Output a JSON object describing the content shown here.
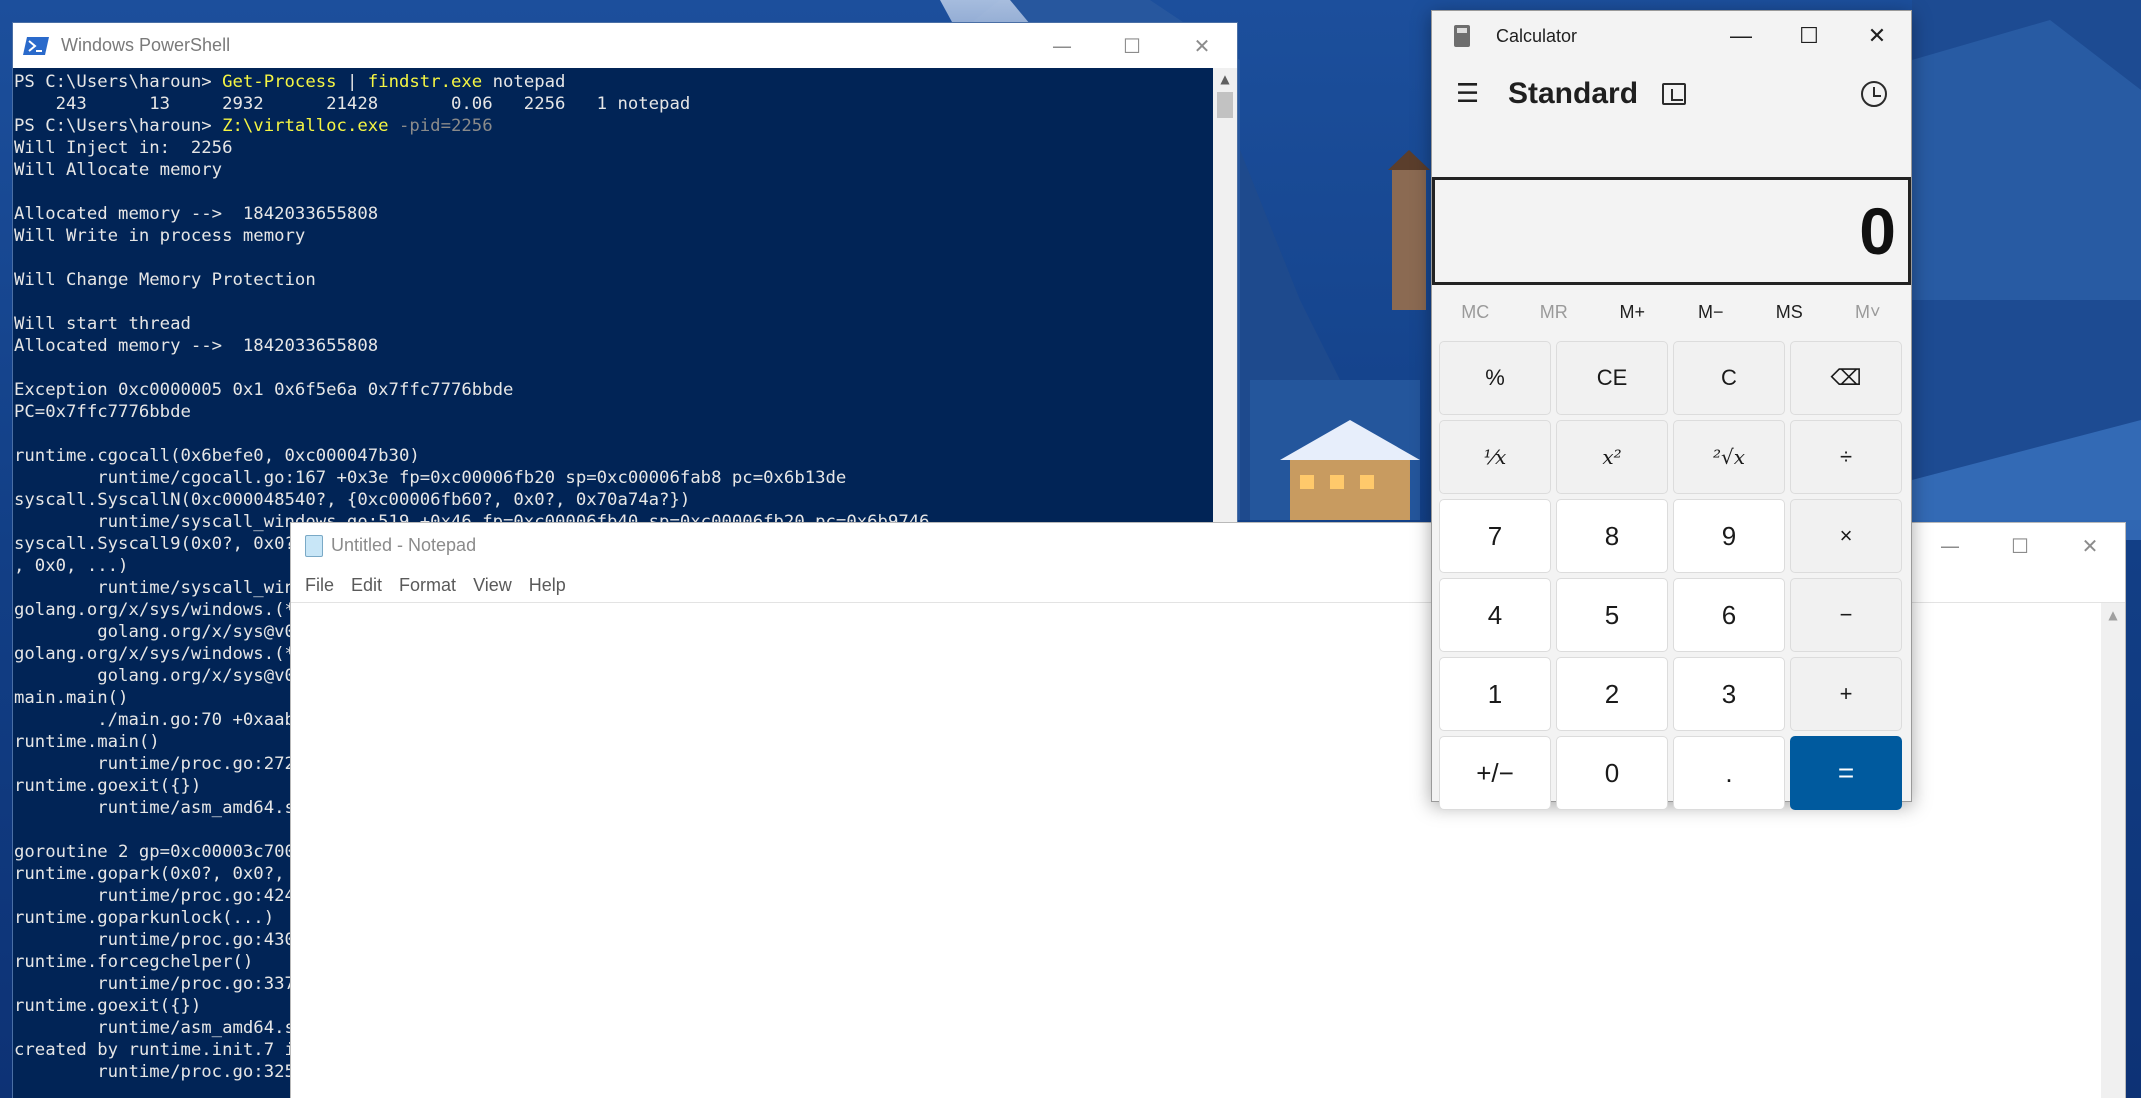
{
  "desktop": {
    "wallpaper": "mountain-village-night"
  },
  "powershell": {
    "title": "Windows PowerShell",
    "lines": [
      [
        {
          "t": "PS C:\\Users\\haroun> ",
          "c": "text"
        },
        {
          "t": "Get-Process",
          "c": "cmd"
        },
        {
          "t": " | ",
          "c": "text"
        },
        {
          "t": "findstr.exe",
          "c": "cmd"
        },
        {
          "t": " notepad",
          "c": "text"
        }
      ],
      [
        {
          "t": "    243      13     2932      21428       0.06   2256   1 notepad",
          "c": "text"
        }
      ],
      [
        {
          "t": "PS C:\\Users\\haroun> ",
          "c": "text"
        },
        {
          "t": "Z:\\virtalloc.exe",
          "c": "cmd"
        },
        {
          "t": " -pid=2256",
          "c": "arg"
        }
      ],
      [
        {
          "t": "Will Inject in:  2256",
          "c": "text"
        }
      ],
      [
        {
          "t": "Will Allocate memory",
          "c": "text"
        }
      ],
      [
        {
          "t": "",
          "c": "text"
        }
      ],
      [
        {
          "t": "Allocated memory -->  1842033655808",
          "c": "text"
        }
      ],
      [
        {
          "t": "Will Write in process memory",
          "c": "text"
        }
      ],
      [
        {
          "t": "",
          "c": "text"
        }
      ],
      [
        {
          "t": "Will Change Memory Protection",
          "c": "text"
        }
      ],
      [
        {
          "t": "",
          "c": "text"
        }
      ],
      [
        {
          "t": "Will start thread",
          "c": "text"
        }
      ],
      [
        {
          "t": "Allocated memory -->  1842033655808",
          "c": "text"
        }
      ],
      [
        {
          "t": "",
          "c": "text"
        }
      ],
      [
        {
          "t": "Exception 0xc0000005 0x1 0x6f5e6a 0x7ffc7776bbde",
          "c": "text"
        }
      ],
      [
        {
          "t": "PC=0x7ffc7776bbde",
          "c": "text"
        }
      ],
      [
        {
          "t": "",
          "c": "text"
        }
      ],
      [
        {
          "t": "runtime.cgocall(0x6befe0, 0xc000047b30)",
          "c": "text"
        }
      ],
      [
        {
          "t": "        runtime/cgocall.go:167 +0x3e fp=0xc00006fb20 sp=0xc00006fab8 pc=0x6b13de",
          "c": "text"
        }
      ],
      [
        {
          "t": "syscall.SyscallN(0xc000048540?, {0xc00006fb60?, 0x0?, 0x70a74a?})",
          "c": "text"
        }
      ],
      [
        {
          "t": "        runtime/syscall_windows.go:519 +0x46 fp=0xc00006fb40 sp=0xc00006fb20 pc=0x6b9746",
          "c": "text"
        }
      ],
      [
        {
          "t": "syscall.Syscall9(0x0?, 0x0?,",
          "c": "text"
        }
      ],
      [
        {
          "t": ", 0x0, ...)",
          "c": "text"
        }
      ],
      [
        {
          "t": "        runtime/syscall_wind",
          "c": "text"
        }
      ],
      [
        {
          "t": "golang.org/x/sys/windows.(*P",
          "c": "text"
        }
      ],
      [
        {
          "t": "        golang.org/x/sys@v0.",
          "c": "text"
        }
      ],
      [
        {
          "t": "golang.org/x/sys/windows.(*L",
          "c": "text"
        }
      ],
      [
        {
          "t": "        golang.org/x/sys@v0.",
          "c": "text"
        }
      ],
      [
        {
          "t": "main.main()",
          "c": "text"
        }
      ],
      [
        {
          "t": "        ./main.go:70 +0xaab",
          "c": "text"
        }
      ],
      [
        {
          "t": "runtime.main()",
          "c": "text"
        }
      ],
      [
        {
          "t": "        runtime/proc.go:272",
          "c": "text"
        }
      ],
      [
        {
          "t": "runtime.goexit({})",
          "c": "text"
        }
      ],
      [
        {
          "t": "        runtime/asm_amd64.s:",
          "c": "text"
        }
      ],
      [
        {
          "t": "",
          "c": "text"
        }
      ],
      [
        {
          "t": "goroutine 2 gp=0xc00003c700",
          "c": "text"
        }
      ],
      [
        {
          "t": "runtime.gopark(0x0?, 0x0?, 0",
          "c": "text"
        }
      ],
      [
        {
          "t": "        runtime/proc.go:424",
          "c": "text"
        }
      ],
      [
        {
          "t": "runtime.goparkunlock(...)",
          "c": "text"
        }
      ],
      [
        {
          "t": "        runtime/proc.go:430",
          "c": "text"
        }
      ],
      [
        {
          "t": "runtime.forcegchelper()",
          "c": "text"
        }
      ],
      [
        {
          "t": "        runtime/proc.go:337",
          "c": "text"
        }
      ],
      [
        {
          "t": "runtime.goexit({})",
          "c": "text"
        }
      ],
      [
        {
          "t": "        runtime/asm_amd64.s:",
          "c": "text"
        }
      ],
      [
        {
          "t": "created by runtime.init.7 in",
          "c": "text"
        }
      ],
      [
        {
          "t": "        runtime/proc.go:325",
          "c": "text"
        }
      ]
    ]
  },
  "notepad": {
    "title": "Untitled - Notepad",
    "menu": [
      "File",
      "Edit",
      "Format",
      "View",
      "Help"
    ],
    "content": ""
  },
  "calculator": {
    "title": "Calculator",
    "mode": "Standard",
    "display": "0",
    "memory": [
      {
        "label": "MC",
        "enabled": false
      },
      {
        "label": "MR",
        "enabled": false
      },
      {
        "label": "M+",
        "enabled": true
      },
      {
        "label": "M−",
        "enabled": true
      },
      {
        "label": "MS",
        "enabled": true
      },
      {
        "label": "M˅",
        "enabled": false
      }
    ],
    "keys": [
      {
        "label": "%",
        "kind": "func",
        "name": "percent"
      },
      {
        "label": "CE",
        "kind": "func",
        "name": "clear-entry"
      },
      {
        "label": "C",
        "kind": "func",
        "name": "clear"
      },
      {
        "label": "⌫",
        "kind": "func",
        "name": "backspace"
      },
      {
        "label": "¹⁄x",
        "kind": "func small",
        "name": "reciprocal"
      },
      {
        "label": "x²",
        "kind": "func small",
        "name": "square"
      },
      {
        "label": "²√x",
        "kind": "func small",
        "name": "square-root"
      },
      {
        "label": "÷",
        "kind": "func",
        "name": "divide"
      },
      {
        "label": "7",
        "kind": "digit",
        "name": "digit-7"
      },
      {
        "label": "8",
        "kind": "digit",
        "name": "digit-8"
      },
      {
        "label": "9",
        "kind": "digit",
        "name": "digit-9"
      },
      {
        "label": "×",
        "kind": "func",
        "name": "multiply"
      },
      {
        "label": "4",
        "kind": "digit",
        "name": "digit-4"
      },
      {
        "label": "5",
        "kind": "digit",
        "name": "digit-5"
      },
      {
        "label": "6",
        "kind": "digit",
        "name": "digit-6"
      },
      {
        "label": "−",
        "kind": "func",
        "name": "subtract"
      },
      {
        "label": "1",
        "kind": "digit",
        "name": "digit-1"
      },
      {
        "label": "2",
        "kind": "digit",
        "name": "digit-2"
      },
      {
        "label": "3",
        "kind": "digit",
        "name": "digit-3"
      },
      {
        "label": "+",
        "kind": "func",
        "name": "add"
      },
      {
        "label": "+/−",
        "kind": "digit",
        "name": "negate"
      },
      {
        "label": "0",
        "kind": "digit",
        "name": "digit-0"
      },
      {
        "label": ".",
        "kind": "digit",
        "name": "decimal"
      },
      {
        "label": "=",
        "kind": "equals",
        "name": "equals"
      }
    ],
    "accent": "#005a9e"
  }
}
